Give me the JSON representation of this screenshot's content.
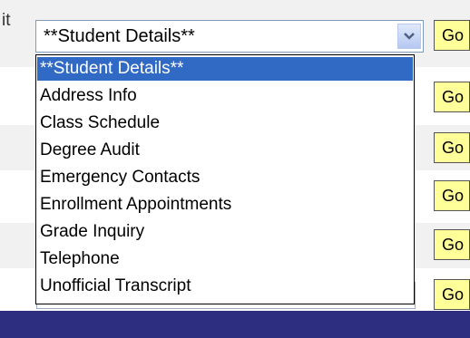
{
  "fragment_text": "it",
  "select": {
    "value": "**Student Details**",
    "options": [
      "**Student Details**",
      "Address Info",
      "Class Schedule",
      "Degree Audit",
      "Emergency Contacts",
      "Enrollment Appointments",
      "Grade Inquiry",
      "Telephone",
      "Unofficial Transcript"
    ],
    "selected_index": 0
  },
  "buttons": {
    "go_label": "Go"
  },
  "colors": {
    "selected_bg": "#316ac5",
    "button_bg": "#ffff99",
    "bottom_bar": "#2e2e80"
  }
}
